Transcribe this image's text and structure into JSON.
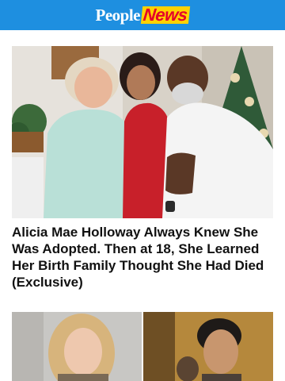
{
  "header": {
    "logo_people": "People",
    "logo_news": "News",
    "brand_color": "#1e8fe0",
    "news_color": "#e4002b"
  },
  "feature": {
    "image_icon": "photo-icon",
    "headline": "Alicia Mae Holloway Always Knew She Was Adopted. Then at 18, She Learned Her Birth Family Thought She Had Died (Exclusive)"
  },
  "next_story": {
    "image_icon": "photo-icon"
  }
}
